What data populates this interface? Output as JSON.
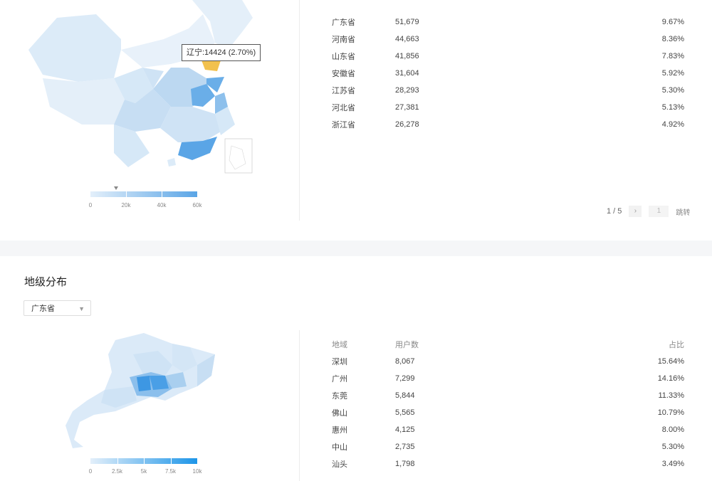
{
  "province_section": {
    "tooltip": "辽宁:14424 (2.70%)",
    "legend": {
      "ticks": [
        "0",
        "20k",
        "40k",
        "60k"
      ],
      "color_low": "#e3effa",
      "color_high": "#5aa5e6",
      "marker_value": 14424,
      "max": 60000
    },
    "highlight_color": "#f2c14e",
    "table": {
      "rows": [
        {
          "region": "广东省",
          "users": "51,679",
          "pct": "9.67%"
        },
        {
          "region": "河南省",
          "users": "44,663",
          "pct": "8.36%"
        },
        {
          "region": "山东省",
          "users": "41,856",
          "pct": "7.83%"
        },
        {
          "region": "安徽省",
          "users": "31,604",
          "pct": "5.92%"
        },
        {
          "region": "江苏省",
          "users": "28,293",
          "pct": "5.30%"
        },
        {
          "region": "河北省",
          "users": "27,381",
          "pct": "5.13%"
        },
        {
          "region": "浙江省",
          "users": "26,278",
          "pct": "4.92%"
        }
      ]
    },
    "pager": {
      "status": "1 / 5",
      "next_icon": "›",
      "page_input": "1",
      "jump": "跳转"
    }
  },
  "city_section": {
    "title": "地级分布",
    "select_value": "广东省",
    "legend": {
      "ticks": [
        "0",
        "2.5k",
        "5k",
        "7.5k",
        "10k"
      ],
      "color_low": "#e3effa",
      "color_high": "#1d95e8"
    },
    "table": {
      "headers": {
        "region": "地域",
        "users": "用户数",
        "pct": "占比"
      },
      "rows": [
        {
          "region": "深圳",
          "users": "8,067",
          "pct": "15.64%"
        },
        {
          "region": "广州",
          "users": "7,299",
          "pct": "14.16%"
        },
        {
          "region": "东莞",
          "users": "5,844",
          "pct": "11.33%"
        },
        {
          "region": "佛山",
          "users": "5,565",
          "pct": "10.79%"
        },
        {
          "region": "惠州",
          "users": "4,125",
          "pct": "8.00%"
        },
        {
          "region": "中山",
          "users": "2,735",
          "pct": "5.30%"
        },
        {
          "region": "汕头",
          "users": "1,798",
          "pct": "3.49%"
        }
      ]
    }
  }
}
